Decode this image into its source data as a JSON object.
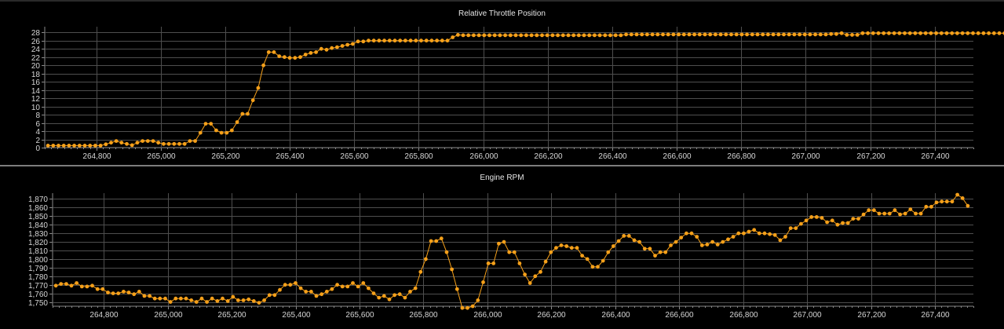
{
  "chart_data": [
    {
      "type": "line",
      "title": "Relative Throttle Position",
      "xlabel": "",
      "ylabel": "",
      "xlim": [
        264640,
        267520
      ],
      "ylim": [
        0,
        29
      ],
      "x_ticks": [
        264800,
        265000,
        265200,
        265400,
        265600,
        265800,
        266000,
        266200,
        266400,
        266600,
        266800,
        267000,
        267200,
        267400
      ],
      "y_ticks": [
        0,
        2,
        4,
        6,
        8,
        10,
        12,
        14,
        16,
        18,
        20,
        22,
        24,
        26,
        28
      ],
      "grid": true,
      "legend": "none",
      "series": [
        {
          "color": "#f5a01a",
          "x_start": 264650,
          "x_step": 16.3,
          "values": [
            0.5,
            0.5,
            0.5,
            0.5,
            0.5,
            0.5,
            0.5,
            0.5,
            0.5,
            0.5,
            0.5,
            0.8,
            1.2,
            1.6,
            1.2,
            0.9,
            0.6,
            1.2,
            1.6,
            1.6,
            1.6,
            1.2,
            0.9,
            0.9,
            0.9,
            0.9,
            0.9,
            1.6,
            1.6,
            3.6,
            5.8,
            5.8,
            4.2,
            3.6,
            3.6,
            4.2,
            6.2,
            8.2,
            8.2,
            11.5,
            14.5,
            20.0,
            23.2,
            23.2,
            22.2,
            22.0,
            21.8,
            21.8,
            22.0,
            22.6,
            23.0,
            23.2,
            24.0,
            23.8,
            24.2,
            24.4,
            24.7,
            25.0,
            25.2,
            25.8,
            25.8,
            26.0,
            26.0,
            26.0,
            26.0,
            26.0,
            26.0,
            26.0,
            26.0,
            26.0,
            26.0,
            26.0,
            26.0,
            26.0,
            26.0,
            26.0,
            26.0,
            26.8,
            27.4,
            27.3,
            27.3,
            27.3,
            27.3,
            27.3,
            27.3,
            27.3,
            27.3,
            27.3,
            27.3,
            27.3,
            27.3,
            27.3,
            27.3,
            27.3,
            27.3,
            27.3,
            27.3,
            27.3,
            27.3,
            27.3,
            27.3,
            27.3,
            27.3,
            27.3,
            27.3,
            27.3,
            27.3,
            27.3,
            27.3,
            27.3,
            27.5,
            27.5,
            27.5,
            27.5,
            27.5,
            27.5,
            27.5,
            27.5,
            27.5,
            27.5,
            27.5,
            27.5,
            27.5,
            27.5,
            27.5,
            27.5,
            27.5,
            27.5,
            27.5,
            27.5,
            27.5,
            27.5,
            27.5,
            27.5,
            27.5,
            27.5,
            27.5,
            27.5,
            27.5,
            27.5,
            27.5,
            27.5,
            27.5,
            27.5,
            27.5,
            27.5,
            27.5,
            27.5,
            27.5,
            27.6,
            27.6,
            27.8,
            27.4,
            27.4,
            27.4,
            27.8,
            27.8,
            27.8,
            27.8,
            27.8,
            27.8,
            27.8,
            27.8,
            27.8,
            27.8,
            27.8,
            27.8,
            27.8,
            27.8,
            27.8,
            27.8,
            27.8,
            27.8,
            27.8,
            27.8,
            27.8,
            27.8,
            27.8,
            27.8,
            27.8,
            27.8,
            27.8,
            27.8,
            27.8,
            27.8
          ]
        }
      ]
    },
    {
      "type": "line",
      "title": "Engine RPM",
      "xlabel": "",
      "ylabel": "",
      "xlim": [
        264640,
        267520
      ],
      "ylim": [
        1745,
        1875
      ],
      "x_ticks": [
        264800,
        265000,
        265200,
        265400,
        265600,
        265800,
        266000,
        266200,
        266400,
        266600,
        266800,
        267000,
        267200,
        267400
      ],
      "y_ticks": [
        1750,
        1760,
        1770,
        1780,
        1790,
        1800,
        1810,
        1820,
        1830,
        1840,
        1850,
        1860,
        1870
      ],
      "grid": true,
      "legend": "none",
      "series": [
        {
          "color": "#f5a01a",
          "x_start": 264650,
          "x_step": 16.3,
          "values": [
            1769,
            1771,
            1771,
            1769,
            1772,
            1768,
            1768,
            1769,
            1765,
            1765,
            1761,
            1760,
            1760,
            1762,
            1761,
            1759,
            1762,
            1757,
            1757,
            1754,
            1754,
            1754,
            1750,
            1754,
            1754,
            1754,
            1752,
            1750,
            1754,
            1750,
            1754,
            1751,
            1754,
            1751,
            1756,
            1752,
            1752,
            1753,
            1751,
            1749,
            1752,
            1758,
            1758,
            1764,
            1770,
            1770,
            1772,
            1766,
            1762,
            1762,
            1757,
            1759,
            1762,
            1765,
            1770,
            1768,
            1768,
            1772,
            1768,
            1772,
            1766,
            1760,
            1755,
            1757,
            1753,
            1758,
            1759,
            1755,
            1762,
            1766,
            1785,
            1800,
            1821,
            1821,
            1824,
            1808,
            1788,
            1765,
            1743,
            1743,
            1745,
            1752,
            1773,
            1795,
            1795,
            1818,
            1820,
            1808,
            1808,
            1795,
            1782,
            1772,
            1780,
            1785,
            1797,
            1808,
            1813,
            1816,
            1815,
            1813,
            1813,
            1804,
            1800,
            1791,
            1791,
            1798,
            1808,
            1815,
            1821,
            1827,
            1827,
            1822,
            1820,
            1812,
            1812,
            1804,
            1808,
            1808,
            1816,
            1820,
            1825,
            1830,
            1830,
            1826,
            1816,
            1817,
            1820,
            1817,
            1820,
            1823,
            1826,
            1830,
            1830,
            1832,
            1834,
            1830,
            1830,
            1829,
            1828,
            1822,
            1826,
            1836,
            1836,
            1841,
            1845,
            1849,
            1849,
            1848,
            1843,
            1845,
            1840,
            1842,
            1842,
            1847,
            1847,
            1852,
            1857,
            1857,
            1853,
            1853,
            1853,
            1857,
            1852,
            1853,
            1858,
            1853,
            1853,
            1861,
            1861,
            1866,
            1867,
            1867,
            1867,
            1875,
            1871,
            1862
          ]
        }
      ]
    }
  ]
}
